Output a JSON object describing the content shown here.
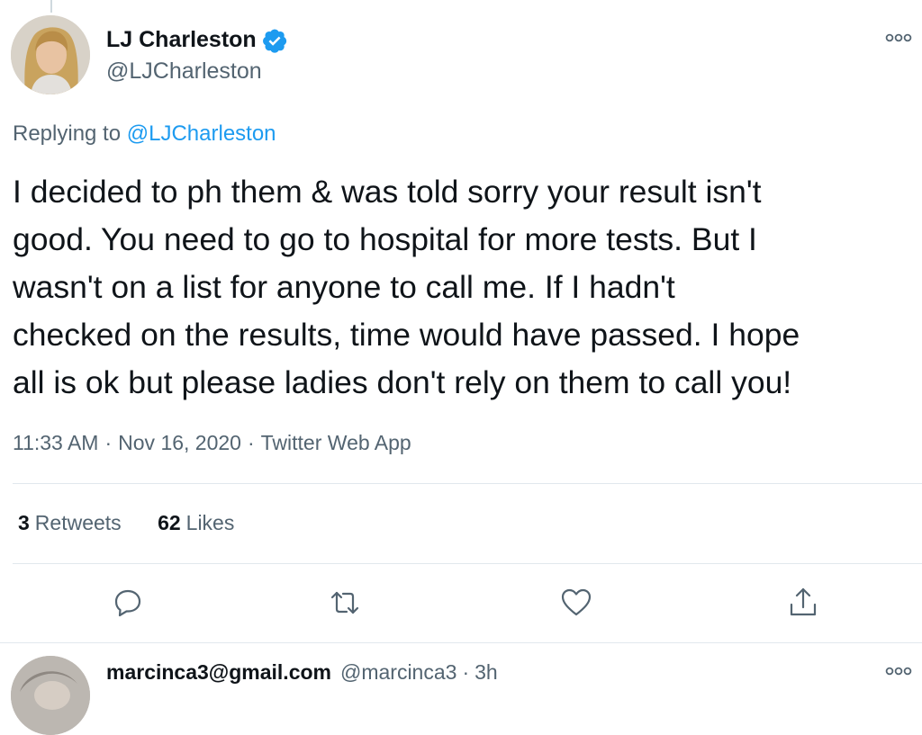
{
  "tweet": {
    "display_name": "LJ Charleston",
    "handle": "@LJCharleston",
    "replying_prefix": "Replying to",
    "replying_to": "@LJCharleston",
    "text": "I decided to ph them & was told sorry your result isn't\ngood. You need to go to hospital for more tests. But I\nwasn't on a list for anyone to call me. If I hadn't\nchecked on the results, time would have passed. I hope\nall is ok but please ladies don't rely on them to call you!",
    "time": "11:33 AM",
    "date": "Nov 16, 2020",
    "separator": "·",
    "source": "Twitter Web App",
    "retweets_count": "3",
    "retweets_label": "Retweets",
    "likes_count": "62",
    "likes_label": "Likes"
  },
  "reply": {
    "display_name": "marcinca3@gmail.com",
    "handle": "@marcinca3",
    "separator": "·",
    "time": "3h"
  },
  "icons": {
    "verified": "verified-badge-icon",
    "more": "more-options-icon",
    "reply": "reply-icon",
    "retweet": "retweet-icon",
    "like": "heart-icon",
    "share": "share-icon"
  },
  "colors": {
    "accent": "#1d9bf0",
    "text": "#0f1419",
    "secondary": "#536471",
    "divider": "#e1e8ed"
  }
}
